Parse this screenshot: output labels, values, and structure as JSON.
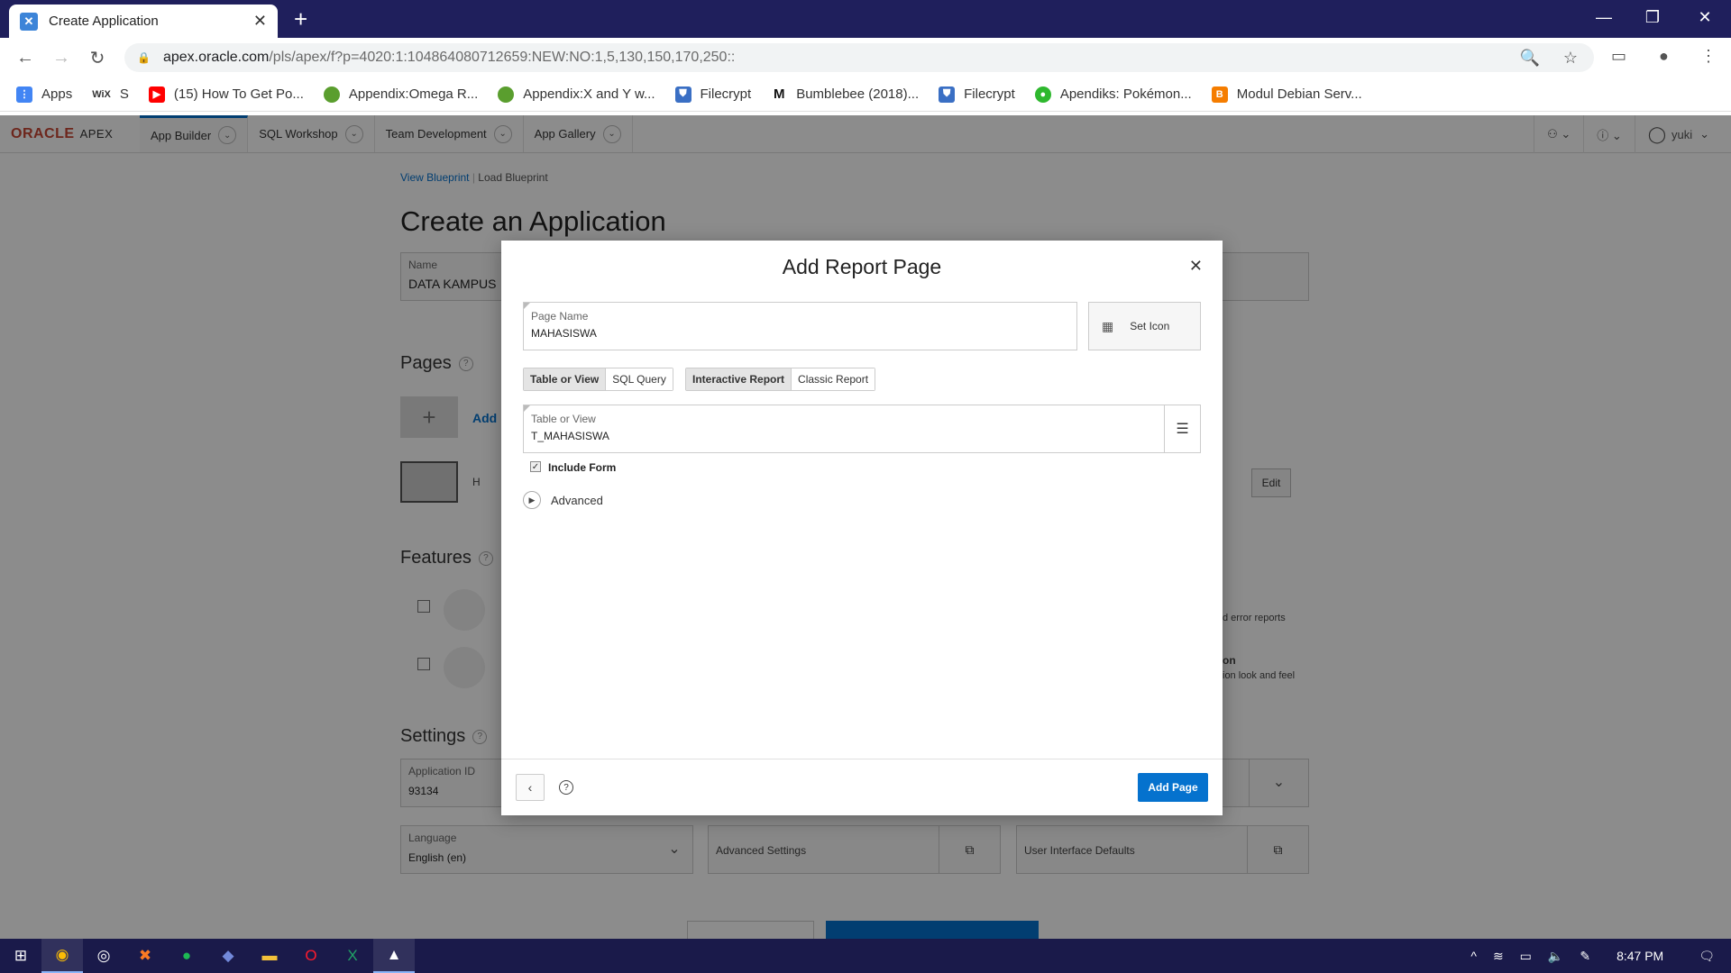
{
  "browser": {
    "tab_title": "Create Application",
    "tab_icon": "apex-favicon",
    "url_host": "apex.oracle.com",
    "url_path": "/pls/apex/f?p=4020:1:104864080712659:NEW:NO:1,5,130,150,170,250::",
    "bookmarks": [
      {
        "label": "Apps",
        "icon": "apps-grid-icon",
        "color": "#4285f4"
      },
      {
        "label": "S",
        "icon": "wix-icon",
        "color": "#000000",
        "prefix": "WiX"
      },
      {
        "label": "(15) How To Get Po...",
        "icon": "youtube-icon",
        "color": "#ff0000"
      },
      {
        "label": "Appendix:Omega R...",
        "icon": "leaf-icon",
        "color": "#5a9e2e"
      },
      {
        "label": "Appendix:X and Y w...",
        "icon": "leaf-icon",
        "color": "#5a9e2e"
      },
      {
        "label": "Filecrypt",
        "icon": "shield-icon",
        "color": "#3a6fc4"
      },
      {
        "label": "Bumblebee (2018)...",
        "icon": "m-logo-icon",
        "color": "#111111"
      },
      {
        "label": "Filecrypt",
        "icon": "shield-icon",
        "color": "#3a6fc4"
      },
      {
        "label": "Apendiks: Pokémon...",
        "icon": "pokeball-icon",
        "color": "#2eb82e"
      },
      {
        "label": "Modul Debian Serv...",
        "icon": "blogger-icon",
        "color": "#f57d00"
      }
    ]
  },
  "apex": {
    "logo": "ORACLE",
    "logo_suffix": "APEX",
    "menu": [
      "App Builder",
      "SQL Workshop",
      "Team Development",
      "App Gallery"
    ],
    "user": "yuki"
  },
  "page": {
    "crumb_1": "View Blueprint",
    "crumb_2": "Load Blueprint",
    "title": "Create an Application",
    "name_label": "Name",
    "name_value": "DATA KAMPUS",
    "pages_heading": "Pages",
    "add_label": "Add",
    "home_partial": "H",
    "edit_label": "Edit",
    "features_heading": "Features",
    "feature_right_1": "d error reports",
    "feature_right_2a": "on",
    "feature_right_2b": "ion look and feel",
    "settings_heading": "Settings",
    "app_id_label": "Application ID",
    "app_id_value": "93134",
    "language_label": "Language",
    "language_value": "English (en)",
    "advanced_settings": "Advanced Settings",
    "ui_defaults": "User Interface Defaults"
  },
  "modal": {
    "title": "Add Report Page",
    "page_name_label": "Page Name",
    "page_name_value": "MAHASISWA",
    "set_icon_label": "Set Icon",
    "source_options": [
      "Table or View",
      "SQL Query"
    ],
    "source_selected": "Table or View",
    "report_options": [
      "Interactive Report",
      "Classic Report"
    ],
    "report_selected": "Interactive Report",
    "table_label": "Table or View",
    "table_value": "T_MAHASISWA",
    "include_form_label": "Include Form",
    "include_form_checked": true,
    "advanced_label": "Advanced",
    "add_page_button": "Add Page"
  },
  "taskbar": {
    "time": "8:47 PM"
  }
}
